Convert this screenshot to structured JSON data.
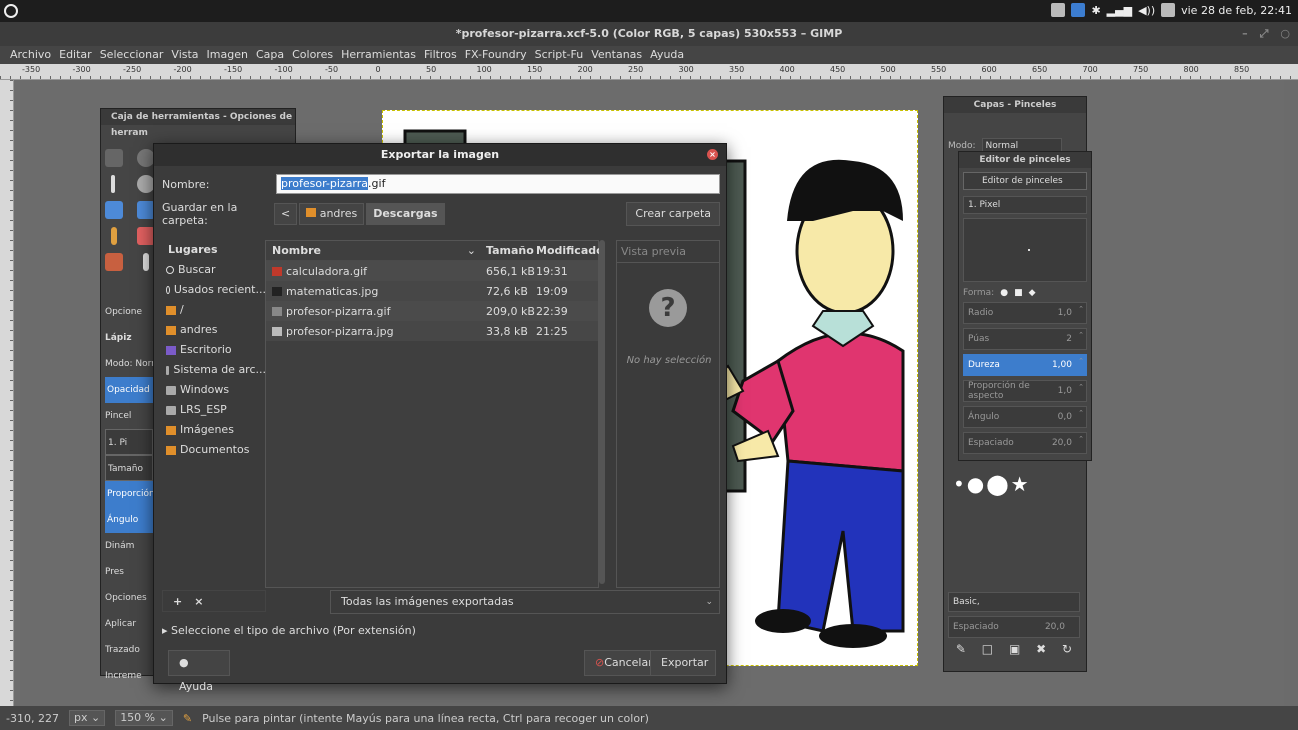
{
  "system_bar": {
    "clock": "vie 28 de feb, 22:41"
  },
  "gimp": {
    "window_title": "*profesor-pizarra.xcf-5.0 (Color RGB, 5 capas) 530x553 – GIMP",
    "menu": [
      "Archivo",
      "Editar",
      "Seleccionar",
      "Vista",
      "Imagen",
      "Capa",
      "Colores",
      "Herramientas",
      "Filtros",
      "FX-Foundry",
      "Script-Fu",
      "Ventanas",
      "Ayuda"
    ],
    "ruler_labels": [
      "-350",
      "-300",
      "-250",
      "-200",
      "-150",
      "-100",
      "-50",
      "0",
      "50",
      "100",
      "150",
      "200",
      "250",
      "300",
      "350",
      "400",
      "450",
      "500",
      "550",
      "600",
      "650",
      "700",
      "750",
      "800",
      "850"
    ]
  },
  "toolbox": {
    "title": "Caja de herramientas - Opciones de herram",
    "options_title": "Opcione",
    "tool_name": "Lápiz",
    "mode_label": "Modo: Norm",
    "opacity": "Opacidad",
    "brush_label": "Pincel",
    "brush_value": "1. Pi",
    "size": "Tamaño",
    "aspect": "Proporción d",
    "angle": "Ángulo",
    "dynamics_label": "Dinám",
    "dynamics_value": "Pres",
    "dyn_options": "Opciones",
    "apply": "Aplicar",
    "stroke": "Trazado",
    "increment": "Increme"
  },
  "dock_layers": {
    "title": "Capas - Pinceles",
    "mode_label": "Modo:",
    "mode_value": "Normal",
    "preset_select": "Basic,",
    "spacing_label": "Espaciado",
    "spacing_value": "20,0"
  },
  "brush_editor": {
    "title": "Editor de pinceles",
    "tab_label": "Editor de pinceles",
    "brush_name": "1. Pixel",
    "shape_label": "Forma:",
    "sliders": [
      {
        "label": "Radio",
        "value": "1,0",
        "active": false
      },
      {
        "label": "Púas",
        "value": "2",
        "active": false
      },
      {
        "label": "Dureza",
        "value": "1,00",
        "active": true
      },
      {
        "label": "Proporción de aspecto",
        "value": "1,0",
        "active": false
      },
      {
        "label": "Ángulo",
        "value": "0,0",
        "active": false
      },
      {
        "label": "Espaciado",
        "value": "20,0",
        "active": false
      }
    ]
  },
  "dialog": {
    "title": "Exportar la imagen",
    "name_label": "Nombre:",
    "name_selected": "profesor-pizarra",
    "name_ext": ".gif",
    "folder_label": "Guardar en la carpeta:",
    "crumb_back": "<",
    "crumb_parent": "andres",
    "crumb_current": "Descargas",
    "create_folder": "Crear carpeta",
    "places_header": "Lugares",
    "places": [
      {
        "label": "Buscar",
        "icon": "search-icon"
      },
      {
        "label": "Usados recient...",
        "icon": "recent-icon"
      },
      {
        "label": "/",
        "icon": "folder-icon"
      },
      {
        "label": "andres",
        "icon": "home-folder-icon"
      },
      {
        "label": "Escritorio",
        "icon": "desktop-icon"
      },
      {
        "label": "Sistema de arc...",
        "icon": "drive-icon"
      },
      {
        "label": "Windows",
        "icon": "drive-icon"
      },
      {
        "label": "LRS_ESP",
        "icon": "drive-icon"
      },
      {
        "label": "Imágenes",
        "icon": "folder-icon"
      },
      {
        "label": "Documentos",
        "icon": "folder-icon"
      }
    ],
    "columns": {
      "name": "Nombre",
      "size": "Tamaño",
      "modified": "Modificado"
    },
    "files": [
      {
        "name": "calculadora.gif",
        "size": "656,1 kB",
        "modified": "19:31"
      },
      {
        "name": "matematicas.jpg",
        "size": "72,6 kB",
        "modified": "19:09"
      },
      {
        "name": "profesor-pizarra.gif",
        "size": "209,0 kB",
        "modified": "22:39"
      },
      {
        "name": "profesor-pizarra.jpg",
        "size": "33,8 kB",
        "modified": "21:25"
      }
    ],
    "preview_header": "Vista previa",
    "no_selection": "No hay selección",
    "filter": "Todas las imágenes exportadas",
    "file_type_expander": "Seleccione el tipo de archivo (Por extensión)",
    "help": "Ayuda",
    "cancel": "Cancelar",
    "export": "Exportar"
  },
  "status": {
    "coords": "-310, 227",
    "unit": "px",
    "zoom": "150 %",
    "message": "Pulse para pintar (intente Mayús para una línea recta, Ctrl para recoger un color)"
  }
}
